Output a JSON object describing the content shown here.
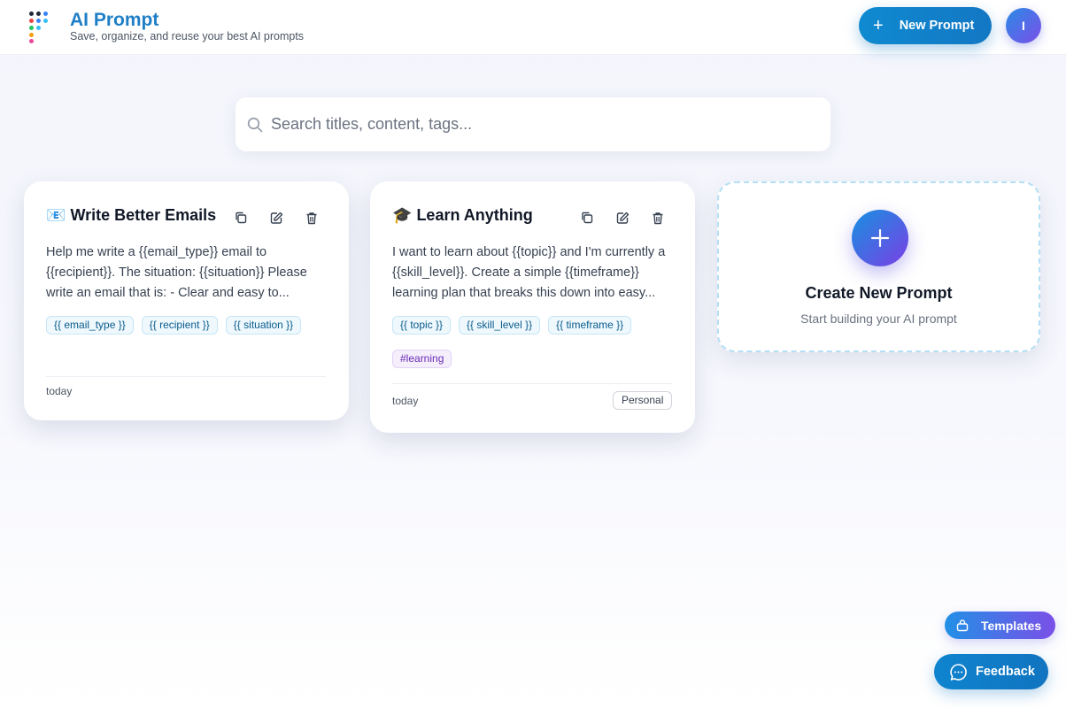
{
  "header": {
    "title": "AI Prompt",
    "subtitle": "Save, organize, and reuse your best AI prompts",
    "new_prompt_label": "New Prompt",
    "avatar_initial": "I"
  },
  "search": {
    "placeholder": "Search titles, content, tags..."
  },
  "cards": [
    {
      "emoji": "📧",
      "title": "Write Better Emails",
      "body": "Help me write a {{email_type}} email to {{recipient}}. The situation: {{situation}} Please write an email that is: - Clear and easy to...",
      "variables": [
        "{{ email_type }}",
        "{{ recipient }}",
        "{{ situation }}"
      ],
      "hashtags": [],
      "date": "today",
      "badge": ""
    },
    {
      "emoji": "🎓",
      "title": "Learn Anything",
      "body": "I want to learn about {{topic}} and I'm currently a {{skill_level}}. Create a simple {{timeframe}} learning plan that breaks this down into easy...",
      "variables": [
        "{{ topic }}",
        "{{ skill_level }}",
        "{{ timeframe }}"
      ],
      "hashtags": [
        "#learning"
      ],
      "date": "today",
      "badge": "Personal"
    }
  ],
  "create_card": {
    "title": "Create New Prompt",
    "subtitle": "Start building your AI prompt"
  },
  "floating": {
    "templates_label": "Templates",
    "feedback_label": "Feedback"
  },
  "icons": {
    "card_actions": [
      "copy-icon",
      "edit-icon",
      "trash-icon"
    ]
  },
  "colors": {
    "brand": "#1e7fc6",
    "primary_button": "#1377c4",
    "gradient_start": "#1691e0",
    "gradient_end": "#7b3fe6",
    "variable_tag_text": "#0b5c8c",
    "hashtag_text": "#6a2bb5"
  }
}
